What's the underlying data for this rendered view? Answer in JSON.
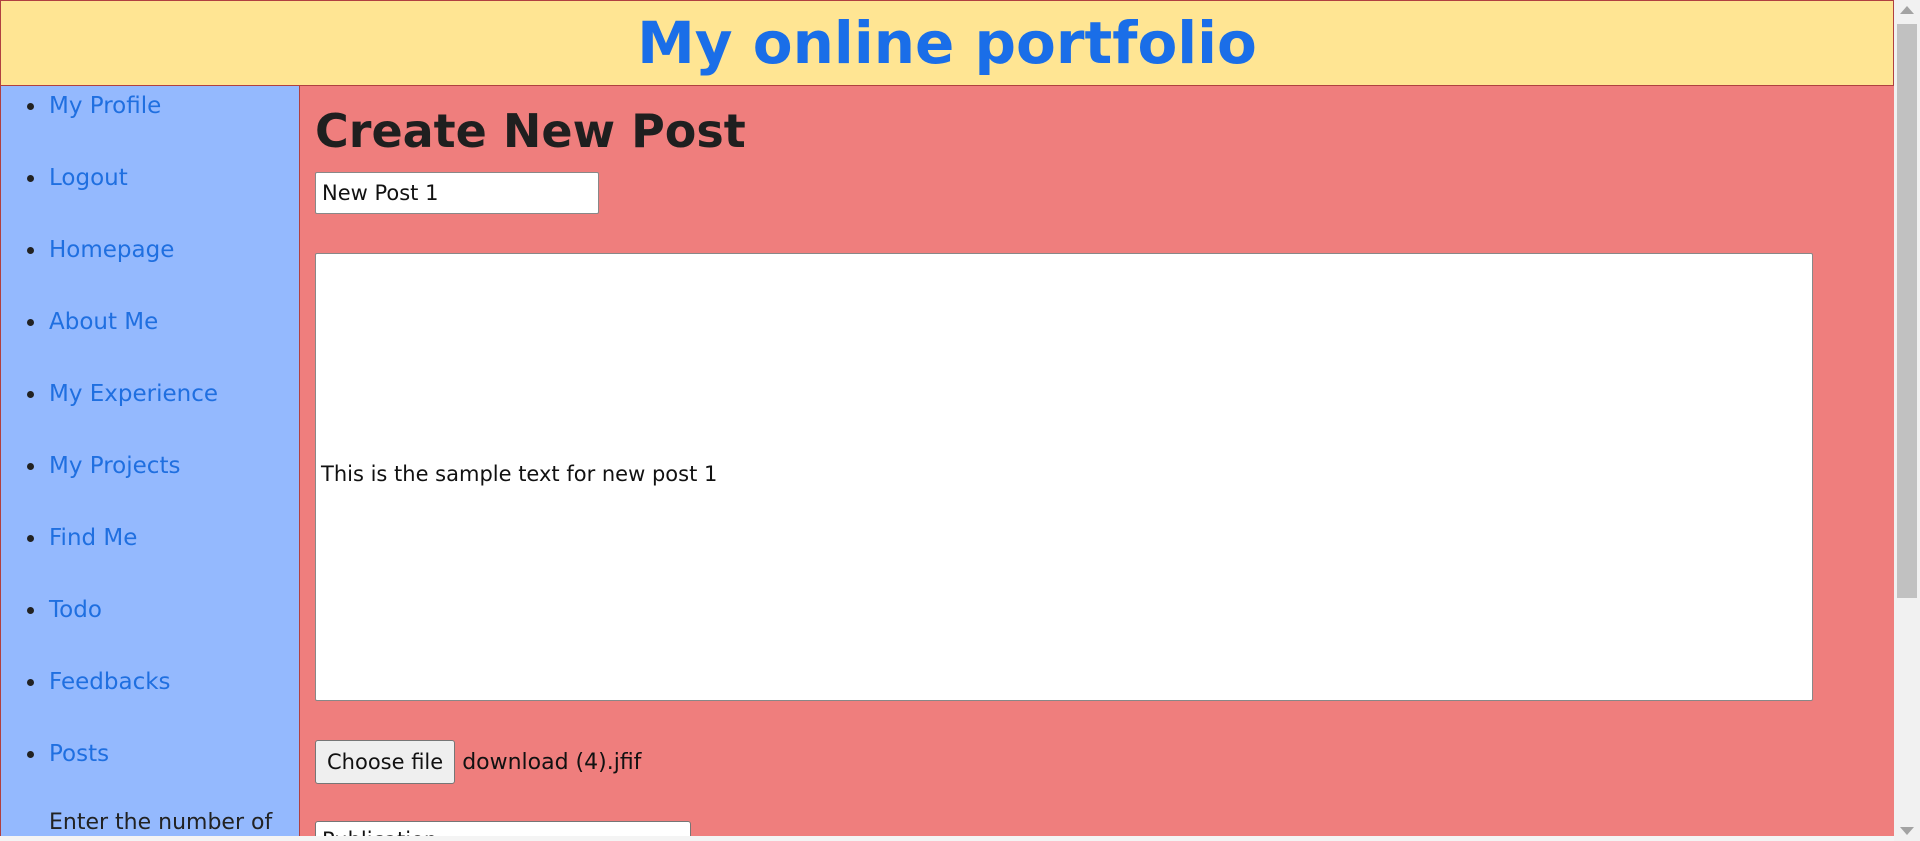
{
  "header": {
    "title": "My online portfolio"
  },
  "sidebar": {
    "items": [
      {
        "label": "My Profile"
      },
      {
        "label": "Logout"
      },
      {
        "label": "Homepage"
      },
      {
        "label": "About Me"
      },
      {
        "label": "My Experience"
      },
      {
        "label": "My Projects"
      },
      {
        "label": "Find Me"
      },
      {
        "label": "Todo"
      },
      {
        "label": "Feedbacks"
      },
      {
        "label": "Posts"
      }
    ],
    "note": "Enter the number of"
  },
  "main": {
    "heading": "Create New Post",
    "title_input_value": "New Post 1",
    "body_text": "This is the sample text for new post 1",
    "file_button_label": "Choose file",
    "file_name": "download (4).jfif",
    "category_selected": "Publication"
  },
  "icons": {
    "scroll_up": "triangle-up",
    "scroll_down": "triangle-down",
    "select_chevron": "chevron-down"
  },
  "colors": {
    "header_bg": "#ffe593",
    "sidebar_bg": "#94b9fe",
    "main_bg": "#ef7e7d",
    "link": "#1f6fe0",
    "title": "#1a6ee8"
  }
}
